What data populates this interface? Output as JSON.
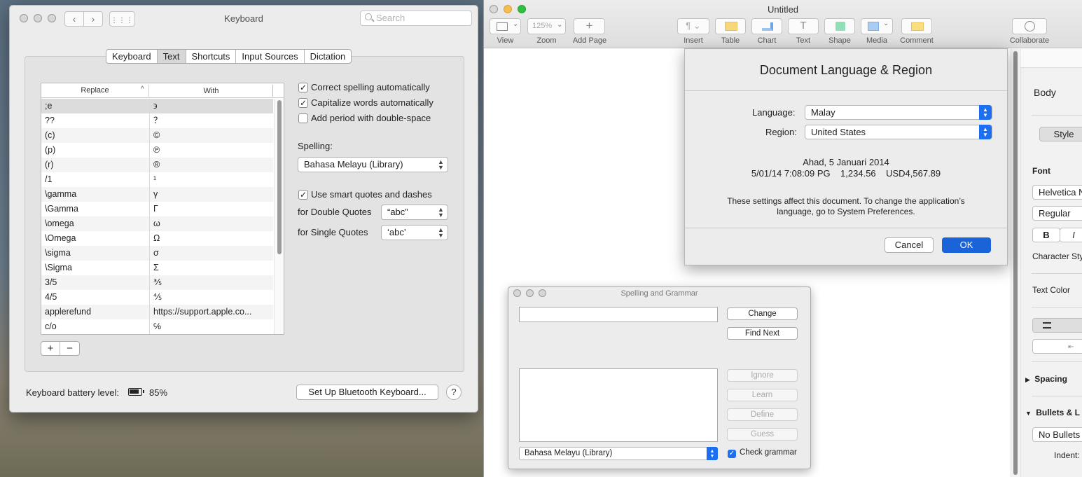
{
  "keyboard_window": {
    "title": "Keyboard",
    "search_placeholder": "Search",
    "tabs": [
      "Keyboard",
      "Text",
      "Shortcuts",
      "Input Sources",
      "Dictation"
    ],
    "active_tab": "Text",
    "table": {
      "col_replace": "Replace",
      "col_with": "With",
      "rows": [
        {
          "replace": ";e",
          "with": "϶"
        },
        {
          "replace": "??",
          "with": "？"
        },
        {
          "replace": "(c)",
          "with": "©"
        },
        {
          "replace": "(p)",
          "with": "℗"
        },
        {
          "replace": "(r)",
          "with": "®"
        },
        {
          "replace": "/1",
          "with": "¹"
        },
        {
          "replace": "\\gamma",
          "with": "γ"
        },
        {
          "replace": "\\Gamma",
          "with": "Γ"
        },
        {
          "replace": "\\omega",
          "with": "ω"
        },
        {
          "replace": "\\Omega",
          "with": "Ω"
        },
        {
          "replace": "\\sigma",
          "with": "σ"
        },
        {
          "replace": "\\Sigma",
          "with": "Σ"
        },
        {
          "replace": "3/5",
          "with": "⅗"
        },
        {
          "replace": "4/5",
          "with": "⅘"
        },
        {
          "replace": "applerefund",
          "with": "https://support.apple.co..."
        },
        {
          "replace": "c/o",
          "with": "℅"
        }
      ]
    },
    "add_label": "+",
    "remove_label": "−",
    "options": {
      "correct_spelling": "Correct spelling automatically",
      "capitalize_words": "Capitalize words automatically",
      "add_period": "Add period with double-space",
      "spelling_label": "Spelling:",
      "spelling_value": "Bahasa Melayu (Library)",
      "smart_quotes": "Use smart quotes and dashes",
      "double_quotes_label": "for Double Quotes",
      "double_quotes_value": "“abc”",
      "single_quotes_label": "for Single Quotes",
      "single_quotes_value": "‘abc’"
    },
    "checks": {
      "correct_spelling": true,
      "capitalize_words": true,
      "add_period": false,
      "smart_quotes": true
    },
    "battery_label": "Keyboard battery level:",
    "battery_value": "85%",
    "battery_level": 0.85,
    "bluetooth_button": "Set Up Bluetooth Keyboard...",
    "help_label": "?"
  },
  "pages_window": {
    "title": "Untitled",
    "toolbar": {
      "view": "View",
      "zoom": "Zoom",
      "zoom_value": "125%",
      "add_page": "Add Page",
      "insert": "Insert",
      "table": "Table",
      "chart": "Chart",
      "text": "Text",
      "shape": "Shape",
      "media": "Media",
      "comment": "Comment",
      "collaborate": "Collaborate"
    },
    "inspector": {
      "paragraph_style": "Body",
      "style_tab": "Style",
      "font_label": "Font",
      "font_name": "Helvetica N",
      "font_weight": "Regular",
      "bold": "B",
      "italic": "I",
      "char_style": "Character Sty",
      "text_color": "Text Color",
      "spacing": "Spacing",
      "bullets": "Bullets & L",
      "bullets_value": "No Bullets",
      "indent": "Indent:"
    }
  },
  "language_dialog": {
    "title": "Document Language & Region",
    "language_label": "Language:",
    "language_value": "Malay",
    "region_label": "Region:",
    "region_value": "United States",
    "date_sample": "Ahad, 5 Januari 2014",
    "sample_line": "5/01/14 7:08:09 PG    1,234.56    USD4,567.89",
    "note": "These settings affect this document. To change the application’s language, go to System Preferences.",
    "cancel": "Cancel",
    "ok": "OK"
  },
  "spelling_window": {
    "title": "Spelling and Grammar",
    "change": "Change",
    "find_next": "Find Next",
    "ignore": "Ignore",
    "learn": "Learn",
    "define": "Define",
    "guess": "Guess",
    "language_value": "Bahasa Melayu (Library)",
    "check_grammar": "Check grammar"
  }
}
